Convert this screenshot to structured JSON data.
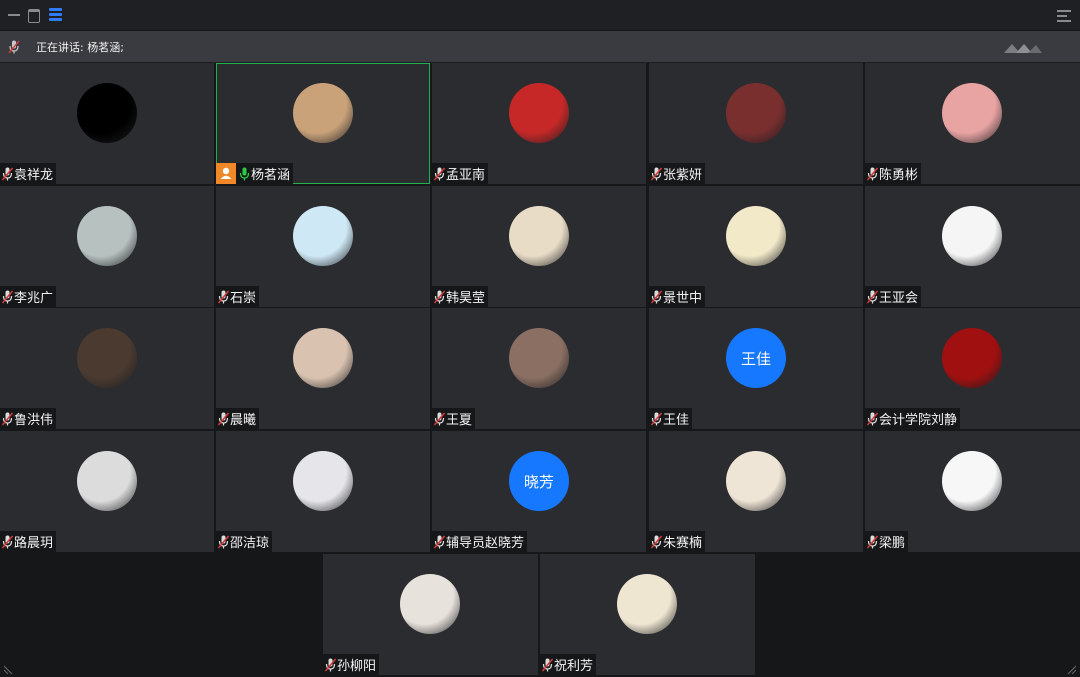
{
  "window": {
    "speaking_label": "正在讲话: 杨茗涵;"
  },
  "colors": {
    "accent_blue": "#1677ff",
    "active_border": "#22b14c",
    "host_badge": "#f0882a"
  },
  "participants": [
    {
      "name": "袁祥龙",
      "avatar": {
        "kind": "image",
        "color": "#000000"
      }
    },
    {
      "name": "杨茗涵",
      "host": true,
      "speaking": true,
      "avatar": {
        "kind": "image",
        "color": "#c9a27a"
      }
    },
    {
      "name": "孟亚南",
      "avatar": {
        "kind": "image",
        "color": "#c62828"
      }
    },
    {
      "name": "张紫妍",
      "avatar": {
        "kind": "image",
        "color": "#7a2f2f"
      }
    },
    {
      "name": "陈勇彬",
      "avatar": {
        "kind": "image",
        "color": "#e8a3a3"
      }
    },
    {
      "name": "李兆广",
      "avatar": {
        "kind": "image",
        "color": "#b7c1bf"
      }
    },
    {
      "name": "石崇",
      "avatar": {
        "kind": "image",
        "color": "#cfe8f5"
      }
    },
    {
      "name": "韩昊莹",
      "avatar": {
        "kind": "image",
        "color": "#e8dcc6"
      }
    },
    {
      "name": "景世中",
      "avatar": {
        "kind": "image",
        "color": "#f2e9c9"
      }
    },
    {
      "name": "王亚会",
      "avatar": {
        "kind": "image",
        "color": "#f5f5f5"
      }
    },
    {
      "name": "鲁洪伟",
      "avatar": {
        "kind": "image",
        "color": "#4a3a30"
      }
    },
    {
      "name": "晨曦",
      "avatar": {
        "kind": "image",
        "color": "#d9c2b0"
      }
    },
    {
      "name": "王夏",
      "avatar": {
        "kind": "image",
        "color": "#8a6f62"
      }
    },
    {
      "name": "王佳",
      "avatar": {
        "kind": "text",
        "text": "王佳",
        "color": "#1677ff"
      }
    },
    {
      "name": "会计学院刘静",
      "avatar": {
        "kind": "image",
        "color": "#a01010"
      }
    },
    {
      "name": "路晨玥",
      "avatar": {
        "kind": "image",
        "color": "#dcdcdc"
      }
    },
    {
      "name": "邵洁琼",
      "avatar": {
        "kind": "image",
        "color": "#e6e6ea"
      }
    },
    {
      "name": "辅导员赵晓芳",
      "avatar": {
        "kind": "text",
        "text": "晓芳",
        "color": "#1677ff"
      }
    },
    {
      "name": "朱赛楠",
      "avatar": {
        "kind": "image",
        "color": "#efe5d6"
      }
    },
    {
      "name": "梁鹏",
      "avatar": {
        "kind": "image",
        "color": "#f7f7f7"
      }
    },
    {
      "name": "孙柳阳",
      "avatar": {
        "kind": "image",
        "color": "#e8e2dc"
      }
    },
    {
      "name": "祝利芳",
      "avatar": {
        "kind": "image",
        "color": "#efe6d2"
      }
    }
  ]
}
